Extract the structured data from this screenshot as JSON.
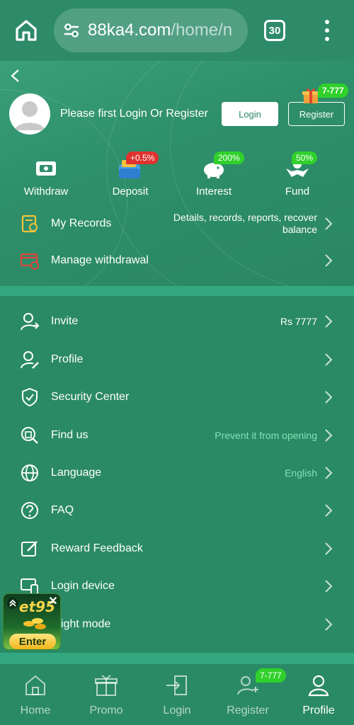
{
  "browser": {
    "url_domain": "88ka4.com",
    "url_path": "/home/n",
    "tab_count": "30"
  },
  "header": {
    "login_prompt": "Please first Login Or Register",
    "login_label": "Login",
    "register_label": "Register",
    "gift_badge": "7-777"
  },
  "quick_actions": [
    {
      "label": "Withdraw",
      "icon": "withdraw-icon",
      "badge": ""
    },
    {
      "label": "Deposit",
      "icon": "deposit-icon",
      "badge": "+0.5%"
    },
    {
      "label": "Interest",
      "icon": "piggy-bank-icon",
      "badge": "200%"
    },
    {
      "label": "Fund",
      "icon": "fund-hands-icon",
      "badge": "50%"
    }
  ],
  "records": [
    {
      "label": "My Records",
      "value_line1": "Details, records, reports, recover",
      "value_line2": "balance"
    },
    {
      "label": "Manage withdrawal",
      "value_line1": "",
      "value_line2": ""
    }
  ],
  "menu": [
    {
      "label": "Invite",
      "value": "Rs 7777"
    },
    {
      "label": "Profile",
      "value": ""
    },
    {
      "label": "Security Center",
      "value": ""
    },
    {
      "label": "Find us",
      "value": "Prevent it from opening"
    },
    {
      "label": "Language",
      "value": "English"
    },
    {
      "label": "FAQ",
      "value": ""
    },
    {
      "label": "Reward Feedback",
      "value": ""
    },
    {
      "label": "Login device",
      "value": ""
    },
    {
      "label": "ight mode",
      "value": ""
    }
  ],
  "bottom_nav": [
    {
      "label": "Home"
    },
    {
      "label": "Promo"
    },
    {
      "label": "Login"
    },
    {
      "label": "Register"
    },
    {
      "label": "Profile"
    }
  ],
  "nav_badge": "7-777",
  "float_ad": {
    "brand": "et95",
    "enter_label": "Enter"
  },
  "colors": {
    "background": "#2a8a66",
    "accent_green_badge": "#2fd12a",
    "red_badge": "#e0322f",
    "value_text_green": "#7fe2b6"
  }
}
